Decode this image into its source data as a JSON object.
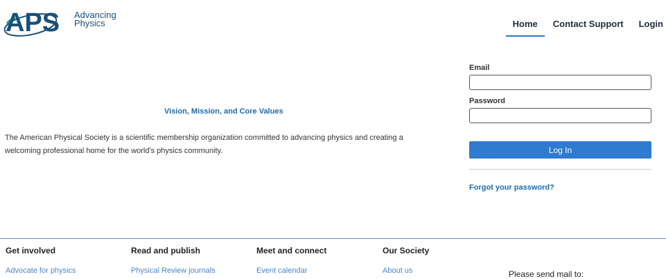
{
  "header": {
    "logo_text": "APS",
    "tagline_line1": "Advancing",
    "tagline_line2": "Physics",
    "nav": [
      "Home",
      "Contact Support",
      "Login"
    ]
  },
  "main": {
    "vision_title": "Vision, Mission, and Core Values",
    "mission_text": "The American Physical Society is a scientific membership organization committed to advancing physics and creating a welcoming professional home for the world's physics community."
  },
  "login_form": {
    "email_label": "Email",
    "email_value": "",
    "password_label": "Password",
    "password_value": "",
    "button_label": "Log In",
    "forgot_label": "Forgot your password?"
  },
  "footer": {
    "columns": [
      {
        "heading": "Get involved",
        "link": "Advocate for physics"
      },
      {
        "heading": "Read and publish",
        "link": "Physical Review journals"
      },
      {
        "heading": "Meet and connect",
        "link": "Event calendar"
      },
      {
        "heading": "Our Society",
        "link": "About us"
      }
    ],
    "mail_text": "Please send mail to:"
  },
  "colors": {
    "brand_dark": "#1a4f7a",
    "link_blue": "#1f6aa8",
    "button_blue": "#2e7bd0",
    "nav_underline": "#2b79c2"
  }
}
